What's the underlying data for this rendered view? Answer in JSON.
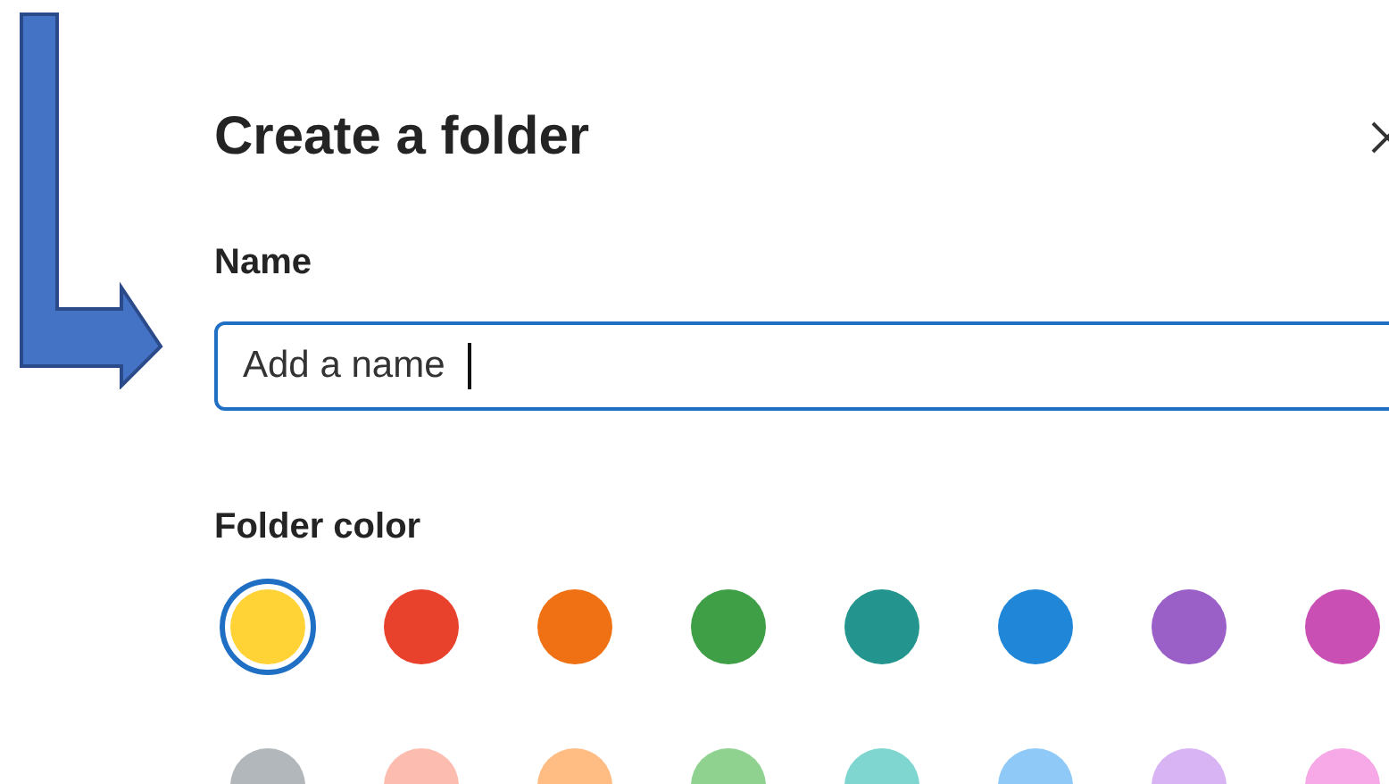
{
  "dialog": {
    "title": "Create a folder",
    "name_label": "Name",
    "name_field": {
      "placeholder": "Add a name",
      "focused": true
    },
    "color_label": "Folder color",
    "colors": [
      {
        "color": "#ffd335",
        "selected": true
      },
      {
        "color": "#e8412c",
        "selected": false
      },
      {
        "color": "#f07114",
        "selected": false
      },
      {
        "color": "#3f9f46",
        "selected": false
      },
      {
        "color": "#23958e",
        "selected": false
      },
      {
        "color": "#1f86d8",
        "selected": false
      },
      {
        "color": "#9b5fc8",
        "selected": false
      },
      {
        "color": "#c94fb5",
        "selected": false
      },
      {
        "color": "#b1b7ba",
        "selected": false
      },
      {
        "color": "#fdbcb0",
        "selected": false
      },
      {
        "color": "#ffbd84",
        "selected": false
      },
      {
        "color": "#8fd28f",
        "selected": false
      },
      {
        "color": "#7fd5cf",
        "selected": false
      },
      {
        "color": "#8ec9f7",
        "selected": false
      },
      {
        "color": "#d8b4f5",
        "selected": false
      },
      {
        "color": "#f7a8e6",
        "selected": false
      }
    ]
  }
}
